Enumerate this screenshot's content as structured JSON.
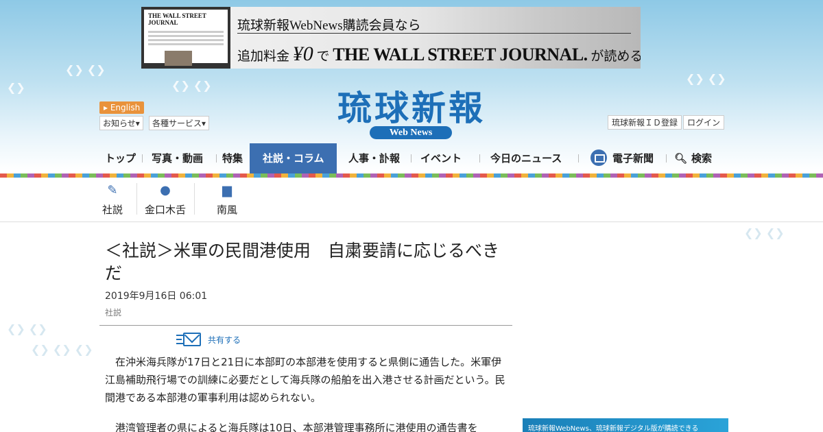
{
  "banner": {
    "laptop_title": "THE WALL STREET JOURNAL",
    "line1": "琉球新報WebNews購読会員なら",
    "line2_prefix": "追加料金",
    "line2_price": "¥0",
    "line2_mid": "で",
    "line2_brand": "THE WALL STREET JOURNAL.",
    "line2_suffix": "が読める"
  },
  "header": {
    "english_label": "English",
    "notice_label": "お知らせ",
    "services_label": "各種サービス",
    "logo_text": "琉球新報",
    "logo_sub": "Web News",
    "register_label": "琉球新報ＩＤ登録",
    "login_label": "ログイン"
  },
  "nav": {
    "items": [
      {
        "label": "トップ"
      },
      {
        "label": "写真・動画"
      },
      {
        "label": "特集"
      },
      {
        "label": "社説・コラム"
      },
      {
        "label": "人事・訃報"
      },
      {
        "label": "イベント"
      },
      {
        "label": "今日のニュース"
      },
      {
        "label": "電子新聞"
      },
      {
        "label": "検索"
      }
    ]
  },
  "subnav": {
    "items": [
      {
        "label": "社説",
        "icon": "pen-icon"
      },
      {
        "label": "金口木舌",
        "icon": "speech-bubble-icon"
      },
      {
        "label": "南風",
        "icon": "comment-icon"
      }
    ]
  },
  "article": {
    "title": "＜社説＞米軍の民間港使用　自粛要請に応じるべきだ",
    "date": "2019年9月16日 06:01",
    "category": "社説",
    "share_label": "共有する",
    "paragraphs": [
      "在沖米海兵隊が17日と21日に本部町の本部港を使用すると県側に通告した。米軍伊江島補助飛行場での訓練に必要だとして海兵隊の船舶を出入港させる計画だという。民間港である本部港の軍事利用は認められない。",
      "港湾管理者の県によると海兵隊は10日、本部港管理事務所に港使用の通告書を"
    ]
  },
  "promo": {
    "text": "琉球新報WebNews、琉球新報デジタル版が購読できる"
  },
  "colors": {
    "accent": "#3c6fb1",
    "logo": "#1d6fb8",
    "english_badge": "#e9923b"
  }
}
